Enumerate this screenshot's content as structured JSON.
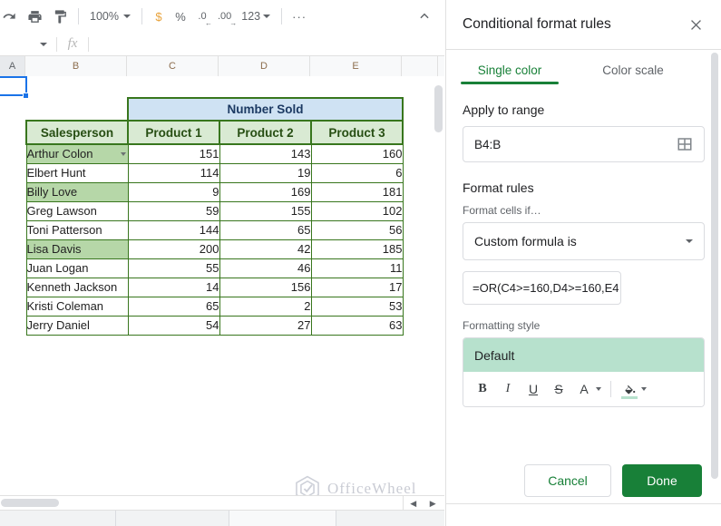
{
  "toolbar": {
    "icons": [
      "redo-icon",
      "print-icon",
      "paint-format-icon"
    ],
    "zoom_value": "100%",
    "currency_label": "$",
    "percent_label": "%",
    "decrease_decimal_label": ".0",
    "increase_decimal_label": ".00",
    "number_format_label": "123",
    "more_label": "···",
    "collapse_icon": "chevron-up-icon"
  },
  "formula_bar": {
    "name_box_value": "",
    "fx_label": "fx",
    "value": ""
  },
  "grid": {
    "column_headers": [
      "A",
      "B",
      "C",
      "D",
      "E",
      "",
      ""
    ],
    "selected_column": "A"
  },
  "table": {
    "group_header": "Number Sold",
    "headers": [
      "Salesperson",
      "Product 1",
      "Product 2",
      "Product 3"
    ],
    "rows": [
      {
        "name": "Arthur Colon",
        "values": [
          151,
          143,
          160
        ],
        "highlighted": true
      },
      {
        "name": "Elbert Hunt",
        "values": [
          114,
          19,
          6
        ],
        "highlighted": false
      },
      {
        "name": "Billy Love",
        "values": [
          9,
          169,
          181
        ],
        "highlighted": true
      },
      {
        "name": "Greg Lawson",
        "values": [
          59,
          155,
          102
        ],
        "highlighted": false
      },
      {
        "name": "Toni Patterson",
        "values": [
          144,
          65,
          56
        ],
        "highlighted": false
      },
      {
        "name": "Lisa Davis",
        "values": [
          200,
          42,
          185
        ],
        "highlighted": true
      },
      {
        "name": "Juan Logan",
        "values": [
          55,
          46,
          11
        ],
        "highlighted": false
      },
      {
        "name": "Kenneth Jackson",
        "values": [
          14,
          156,
          17
        ],
        "highlighted": false
      },
      {
        "name": "Kristi Coleman",
        "values": [
          65,
          2,
          53
        ],
        "highlighted": false
      },
      {
        "name": "Jerry Daniel",
        "values": [
          54,
          27,
          63
        ],
        "highlighted": false
      }
    ],
    "colors": {
      "group_header_bg": "#cfe2f3",
      "group_header_text": "#1c3a63",
      "column_header_bg": "#d9ead3",
      "column_header_text": "#274e13",
      "border": "#38761d",
      "highlight_bg": "#b6d7a8"
    }
  },
  "watermark": {
    "text": "OfficeWheel",
    "icon": "hexagon-logo-icon"
  },
  "panel": {
    "title": "Conditional format rules",
    "close_icon": "close-icon",
    "tabs": [
      {
        "label": "Single color",
        "active": true
      },
      {
        "label": "Color scale",
        "active": false
      }
    ],
    "apply_to_range": {
      "section_label": "Apply to range",
      "value": "B4:B",
      "grid_icon": "select-range-grid-icon"
    },
    "format_rules": {
      "section_label": "Format rules",
      "condition_label": "Format cells if…",
      "condition_value": "Custom formula is",
      "dropdown_icon": "chevron-down-icon",
      "formula_value": "=OR(C4>=160,D4>=160,E4"
    },
    "formatting_style": {
      "label": "Formatting style",
      "preview_text": "Default",
      "preview_bg": "#b7e1cd",
      "tools": [
        {
          "name": "bold-button",
          "glyph": "B"
        },
        {
          "name": "italic-button",
          "glyph": "I"
        },
        {
          "name": "underline-button",
          "glyph": "U"
        },
        {
          "name": "strikethrough-button",
          "glyph": "S"
        },
        {
          "name": "text-color-button",
          "glyph": "A"
        },
        {
          "name": "fill-color-button",
          "glyph": "fill"
        }
      ]
    },
    "actions": {
      "cancel_label": "Cancel",
      "done_label": "Done",
      "done_color": "#188038"
    }
  }
}
